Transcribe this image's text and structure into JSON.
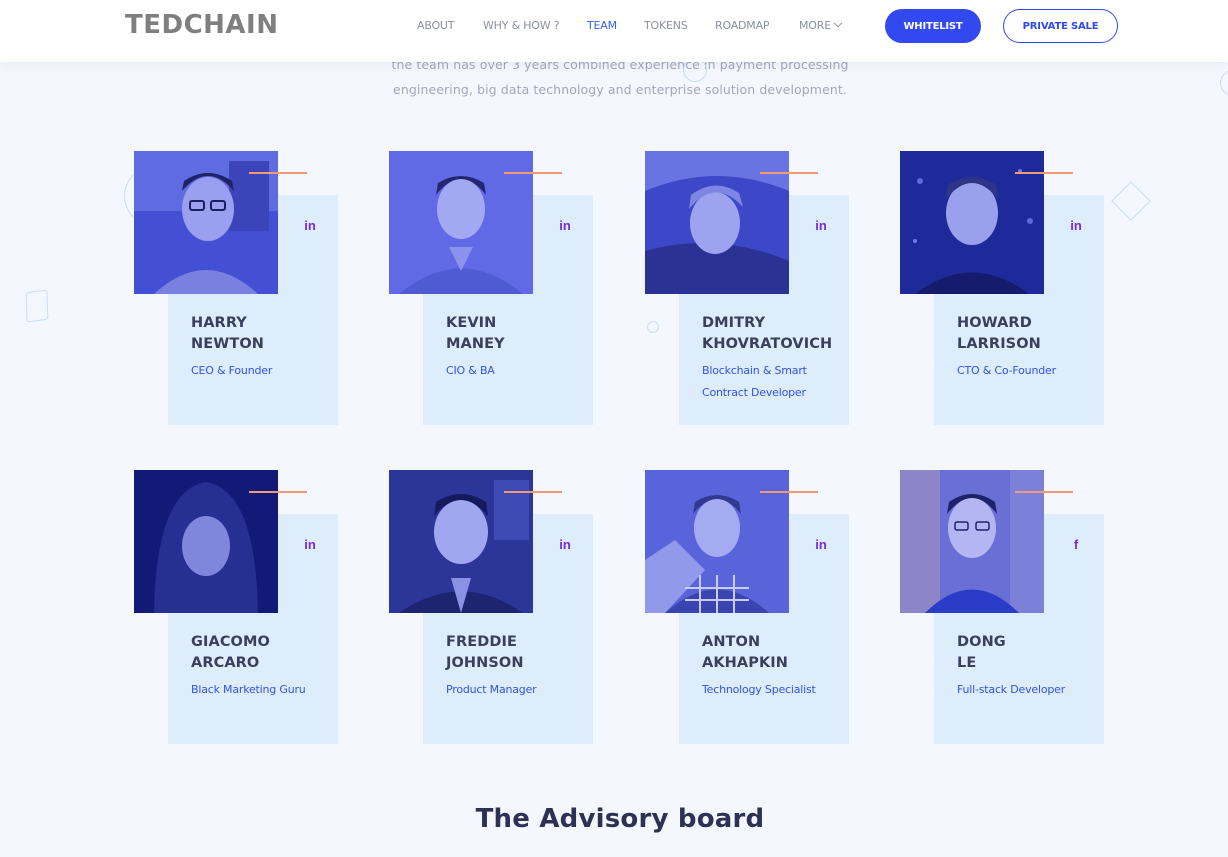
{
  "header": {
    "logo": "TEDCHAIN",
    "nav": [
      {
        "label": "ABOUT",
        "active": false
      },
      {
        "label": "WHY & HOW ?",
        "active": false
      },
      {
        "label": "TEAM",
        "active": true
      },
      {
        "label": "TOKENS",
        "active": false
      },
      {
        "label": "ROADMAP",
        "active": false
      },
      {
        "label": "MORE",
        "active": false
      }
    ],
    "whitelist_label": "WHITELIST",
    "private_sale_label": "PRIVATE SALE"
  },
  "intro": {
    "line1": "the team has over 3 years combined experience in payment processing",
    "line2": "engineering, big data technology and enterprise solution development."
  },
  "team": [
    {
      "first": "HARRY",
      "last": "NEWTON",
      "role": "CEO & Founder",
      "social": "in",
      "social_icon": "linkedin-icon"
    },
    {
      "first": "KEVIN",
      "last": "MANEY",
      "role": "CIO & BA",
      "social": "in",
      "social_icon": "linkedin-icon"
    },
    {
      "first": "DMITRY",
      "last": "KHOVRATOVICH",
      "role": "Blockchain & Smart Contract Developer",
      "social": "in",
      "social_icon": "linkedin-icon"
    },
    {
      "first": "HOWARD",
      "last": "LARRISON",
      "role": "CTO & Co-Founder",
      "social": "in",
      "social_icon": "linkedin-icon"
    },
    {
      "first": "GIACOMO",
      "last": "ARCARO",
      "role": "Black Marketing Guru",
      "social": "in",
      "social_icon": "linkedin-icon"
    },
    {
      "first": "FREDDIE",
      "last": "JOHNSON",
      "role": "Product Manager",
      "social": "in",
      "social_icon": "linkedin-icon"
    },
    {
      "first": "ANTON",
      "last": "AKHAPKIN",
      "role": "Technology Specialist",
      "social": "in",
      "social_icon": "linkedin-icon"
    },
    {
      "first": "DONG",
      "last": "LE",
      "role": "Full-stack Developer",
      "social": "f",
      "social_icon": "facebook-icon"
    }
  ],
  "advisory": {
    "title": "The Advisory board"
  },
  "colors": {
    "accent_blue": "#3249ef",
    "accent_purple": "#7a2ad9",
    "card_bg": "#ddedfc",
    "accent_line": "#f09a7a"
  }
}
